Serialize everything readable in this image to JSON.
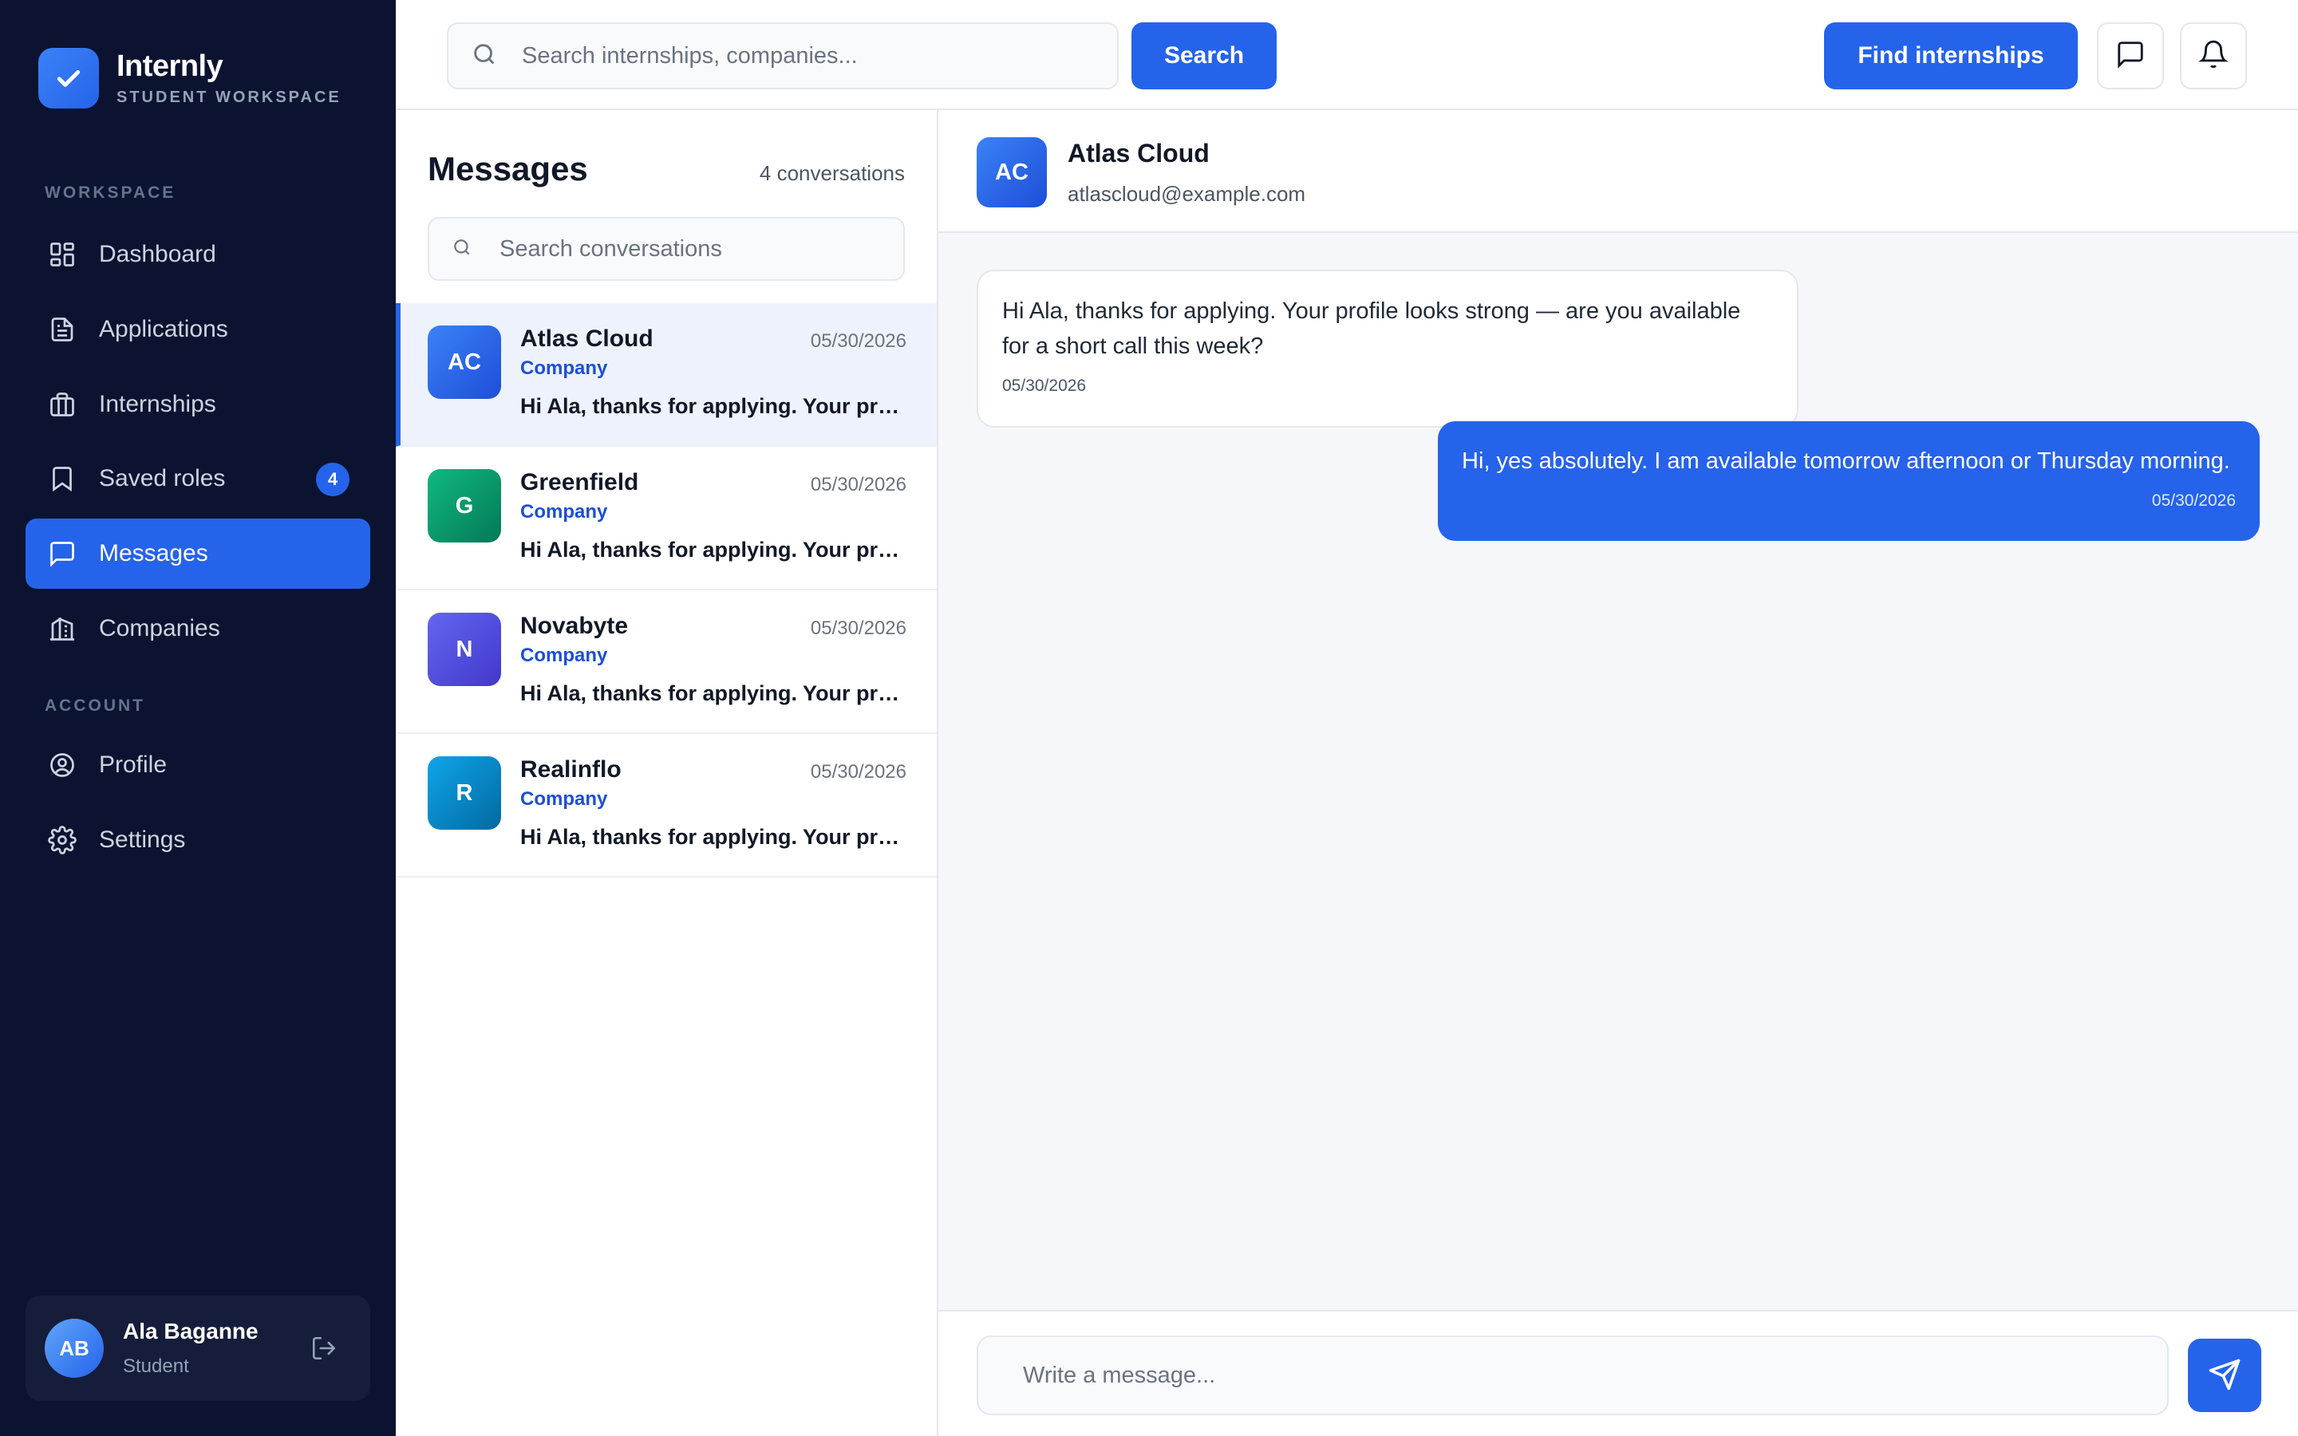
{
  "brand": {
    "name": "Internly",
    "subtitle": "STUDENT WORKSPACE",
    "logo_icon": "check-icon",
    "accent": "#2563eb"
  },
  "sidebar": {
    "workspace_heading": "WORKSPACE",
    "workspace_items": [
      {
        "label": "Dashboard",
        "icon": "dashboard-icon",
        "active": false
      },
      {
        "label": "Applications",
        "icon": "document-icon",
        "active": false
      },
      {
        "label": "Internships",
        "icon": "briefcase-icon",
        "active": false
      },
      {
        "label": "Saved roles",
        "icon": "bookmark-icon",
        "active": false,
        "badge": "4"
      },
      {
        "label": "Messages",
        "icon": "message-icon",
        "active": true
      },
      {
        "label": "Companies",
        "icon": "building-icon",
        "active": false
      }
    ],
    "account_heading": "ACCOUNT",
    "account_items": [
      {
        "label": "Profile",
        "icon": "user-circle-icon"
      },
      {
        "label": "Settings",
        "icon": "gear-icon"
      }
    ],
    "user": {
      "initials": "AB",
      "name": "Ala Baganne",
      "role": "Student",
      "logout_icon": "logout-icon"
    }
  },
  "topbar": {
    "search_placeholder": "Search internships, companies...",
    "search_button": "Search",
    "find_button": "Find internships",
    "icons": [
      "message-icon",
      "bell-icon"
    ]
  },
  "messages": {
    "title": "Messages",
    "count": "4 conversations",
    "search_placeholder": "Search conversations",
    "conversations": [
      {
        "initials": "AC",
        "name": "Atlas Cloud",
        "date": "05/30/2026",
        "tag": "Company",
        "preview": "Hi Ala, thanks for applying. Your profile looks strong — are you available for a short call this week?",
        "color": "#2563eb",
        "active": true
      },
      {
        "initials": "G",
        "name": "Greenfield",
        "date": "05/30/2026",
        "tag": "Company",
        "preview": "Hi Ala, thanks for applying. Your profile looks strong — are you available for a short call this week?",
        "color": "#059669",
        "active": false
      },
      {
        "initials": "N",
        "name": "Novabyte",
        "date": "05/30/2026",
        "tag": "Company",
        "preview": "Hi Ala, thanks for applying. Your profile looks strong — are you available for a short call this week?",
        "color": "#4f46e5",
        "active": false
      },
      {
        "initials": "R",
        "name": "Realinflo",
        "date": "05/30/2026",
        "tag": "Company",
        "preview": "Hi Ala, thanks for applying. Your profile looks strong — are you available for a short call this week?",
        "color": "#0284c7",
        "active": false
      }
    ]
  },
  "chat": {
    "initials": "AC",
    "name": "Atlas Cloud",
    "email": "atlascloud@example.com",
    "messages": [
      {
        "direction": "in",
        "text": "Hi Ala, thanks for applying. Your profile looks strong — are you available for a short call this week?",
        "date": "05/30/2026"
      },
      {
        "direction": "out",
        "text": "Hi, yes absolutely. I am available tomorrow afternoon or Thursday morning.",
        "date": "05/30/2026"
      }
    ],
    "composer_placeholder": "Write a message...",
    "send_icon": "send-icon"
  }
}
